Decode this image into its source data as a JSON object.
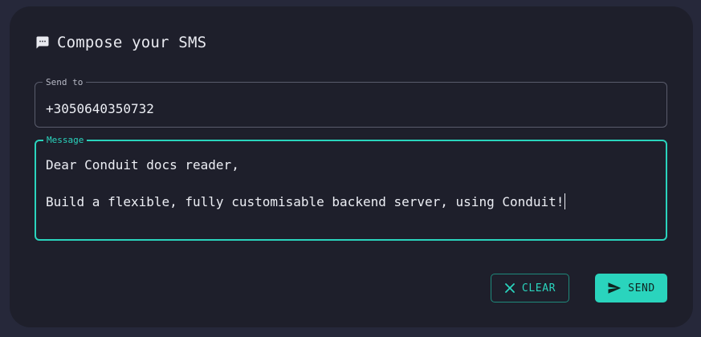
{
  "header": {
    "title": "Compose your SMS",
    "icon": "chat-icon"
  },
  "send_to": {
    "label": "Send to",
    "value": "+3050640350732"
  },
  "message": {
    "label": "Message",
    "line1": "Dear Conduit docs reader,",
    "line2": "",
    "line3": "Build a flexible, fully customisable backend server, using Conduit!"
  },
  "actions": {
    "clear_label": "CLEAR",
    "send_label": "SEND",
    "clear_icon": "close-icon",
    "send_icon": "send-icon"
  },
  "colors": {
    "accent": "#2ad4bd",
    "card_background": "#1e1f2b",
    "page_background": "#26283a"
  }
}
